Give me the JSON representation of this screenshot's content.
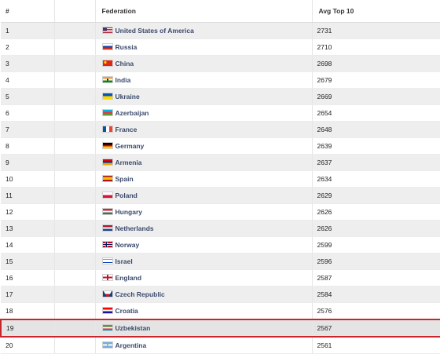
{
  "table": {
    "headers": {
      "rank": "#",
      "blank": "",
      "federation": "Federation",
      "avg": "Avg Top 10"
    },
    "highlight_rank": "19",
    "rows": [
      {
        "rank": "1",
        "federation": "United States of America",
        "avg": "2731",
        "flag": "usa-flag-icon"
      },
      {
        "rank": "2",
        "federation": "Russia",
        "avg": "2710",
        "flag": "russia-flag-icon"
      },
      {
        "rank": "3",
        "federation": "China",
        "avg": "2698",
        "flag": "china-flag-icon"
      },
      {
        "rank": "4",
        "federation": "India",
        "avg": "2679",
        "flag": "india-flag-icon"
      },
      {
        "rank": "5",
        "federation": "Ukraine",
        "avg": "2669",
        "flag": "ukraine-flag-icon"
      },
      {
        "rank": "6",
        "federation": "Azerbaijan",
        "avg": "2654",
        "flag": "azerbaijan-flag-icon"
      },
      {
        "rank": "7",
        "federation": "France",
        "avg": "2648",
        "flag": "france-flag-icon"
      },
      {
        "rank": "8",
        "federation": "Germany",
        "avg": "2639",
        "flag": "germany-flag-icon"
      },
      {
        "rank": "9",
        "federation": "Armenia",
        "avg": "2637",
        "flag": "armenia-flag-icon"
      },
      {
        "rank": "10",
        "federation": "Spain",
        "avg": "2634",
        "flag": "spain-flag-icon"
      },
      {
        "rank": "11",
        "federation": "Poland",
        "avg": "2629",
        "flag": "poland-flag-icon"
      },
      {
        "rank": "12",
        "federation": "Hungary",
        "avg": "2626",
        "flag": "hungary-flag-icon"
      },
      {
        "rank": "13",
        "federation": "Netherlands",
        "avg": "2626",
        "flag": "netherlands-flag-icon"
      },
      {
        "rank": "14",
        "federation": "Norway",
        "avg": "2599",
        "flag": "norway-flag-icon"
      },
      {
        "rank": "15",
        "federation": "Israel",
        "avg": "2596",
        "flag": "israel-flag-icon"
      },
      {
        "rank": "16",
        "federation": "England",
        "avg": "2587",
        "flag": "england-flag-icon"
      },
      {
        "rank": "17",
        "federation": "Czech Republic",
        "avg": "2584",
        "flag": "czech-flag-icon"
      },
      {
        "rank": "18",
        "federation": "Croatia",
        "avg": "2576",
        "flag": "croatia-flag-icon"
      },
      {
        "rank": "19",
        "federation": "Uzbekistan",
        "avg": "2567",
        "flag": "uzbekistan-flag-icon"
      },
      {
        "rank": "20",
        "federation": "Argentina",
        "avg": "2561",
        "flag": "argentina-flag-icon"
      }
    ]
  },
  "colors": {
    "link": "#3b4a6b",
    "highlight_border": "#c8262c",
    "row_alt": "#eeeeee"
  }
}
